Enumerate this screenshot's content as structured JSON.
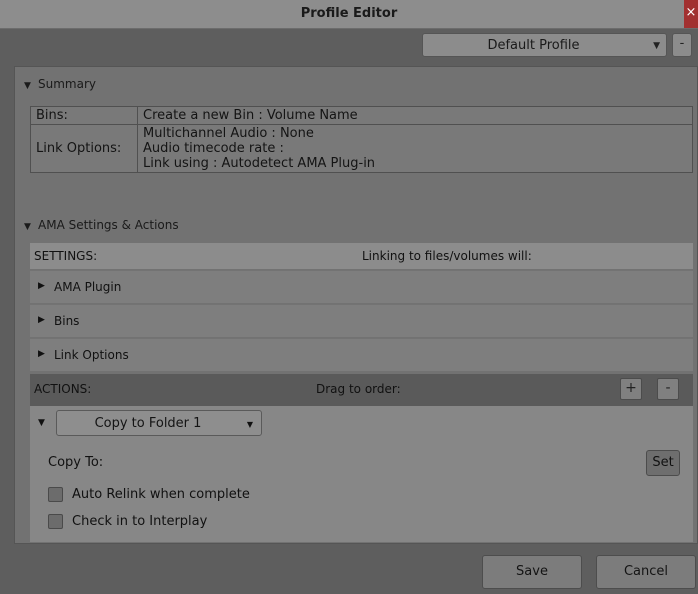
{
  "window": {
    "title": "Profile Editor",
    "close_glyph": "×"
  },
  "profile": {
    "selected": "Default Profile",
    "minus_label": "-"
  },
  "summary": {
    "heading": "Summary",
    "rows": [
      {
        "key": "Bins:",
        "lines": [
          "Create a new Bin : Volume Name"
        ]
      },
      {
        "key": "Link Options:",
        "lines": [
          "Multichannel Audio : None",
          "Audio timecode rate :",
          "Link using : Autodetect AMA Plug-in"
        ]
      }
    ]
  },
  "ama": {
    "heading": "AMA Settings & Actions",
    "settings_label": "SETTINGS:",
    "linking_label": "Linking to files/volumes will:",
    "settings_items": [
      "AMA Plugin",
      "Bins",
      "Link Options"
    ],
    "actions_label": "ACTIONS:",
    "drag_label": "Drag to order:",
    "add_label": "+",
    "remove_label": "-",
    "action": {
      "selected": "Copy to Folder 1",
      "copy_to_label": "Copy To:",
      "set_label": "Set",
      "checkboxes": [
        {
          "label": "Auto Relink when complete",
          "checked": false
        },
        {
          "label": "Check in to Interplay",
          "checked": false
        }
      ]
    }
  },
  "footer": {
    "save_label": "Save",
    "cancel_label": "Cancel"
  }
}
